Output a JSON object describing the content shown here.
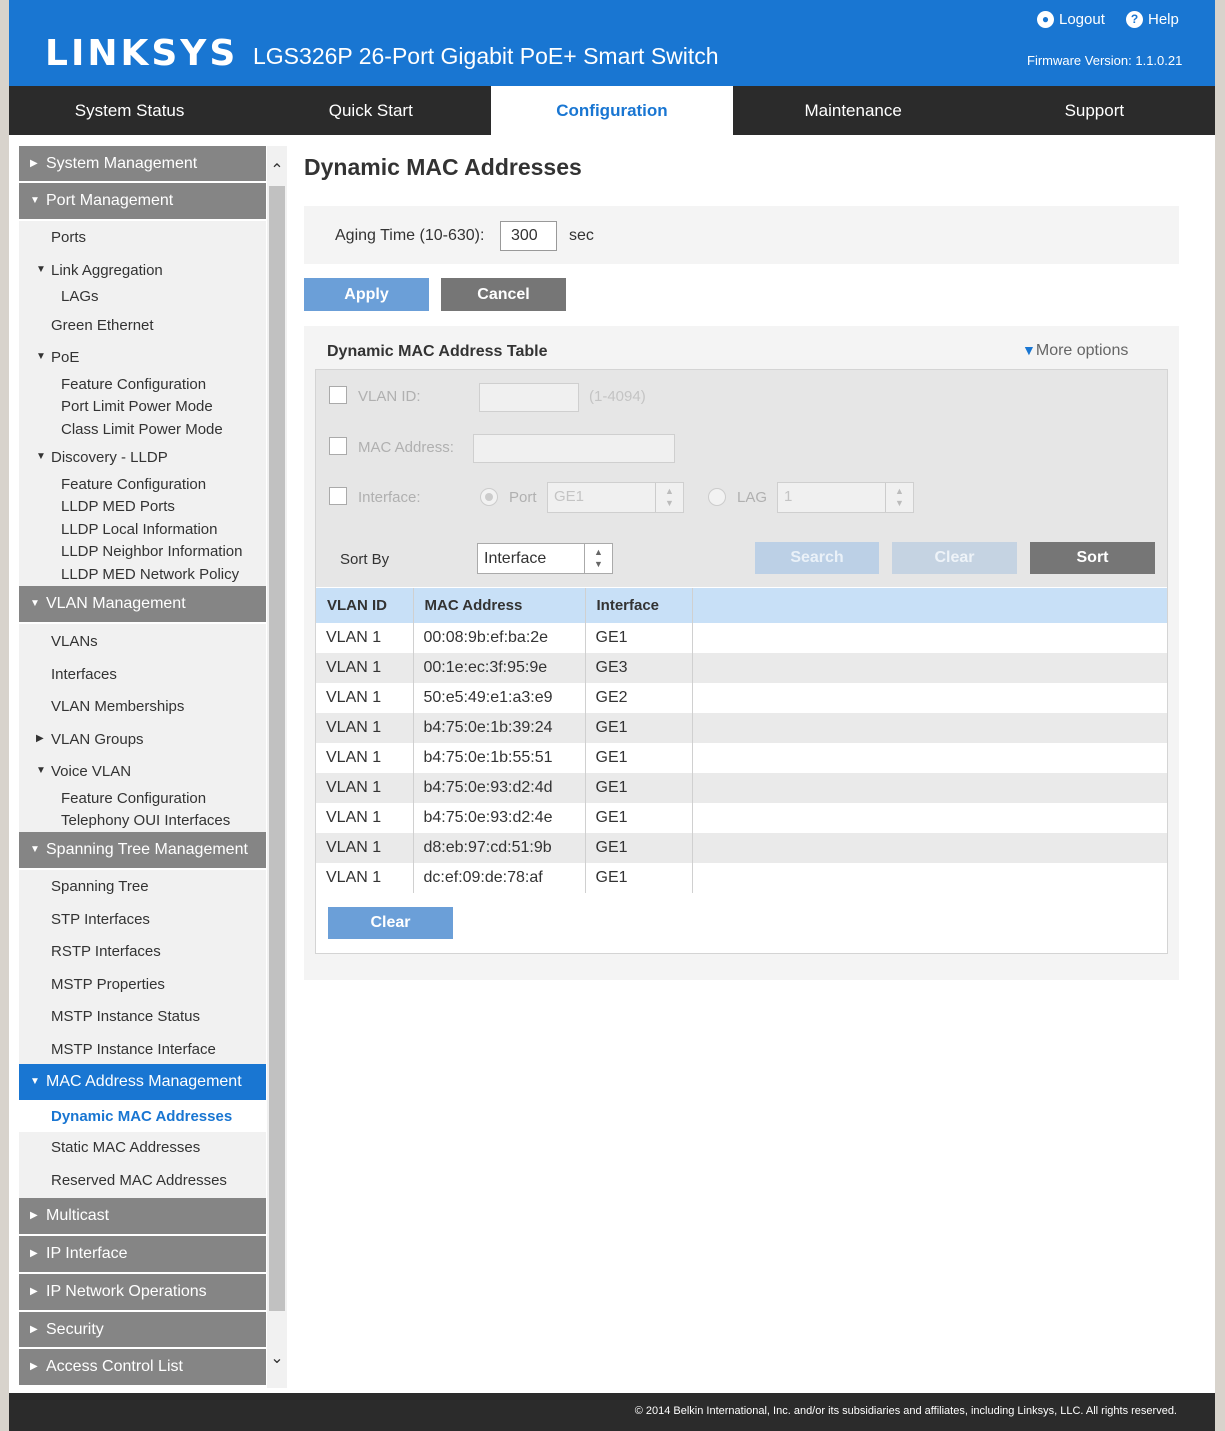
{
  "header": {
    "logo": "LINKSYS",
    "product": "LGS326P 26-Port Gigabit PoE+ Smart Switch",
    "logout": "Logout",
    "help": "Help",
    "firmware": "Firmware Version: 1.1.0.21"
  },
  "nav": {
    "tabs": [
      "System Status",
      "Quick Start",
      "Configuration",
      "Maintenance",
      "Support"
    ],
    "active": "Configuration"
  },
  "sidebar": {
    "system_management": "System Management",
    "port_management": "Port Management",
    "ports": "Ports",
    "link_aggregation": "Link Aggregation",
    "lags": "LAGs",
    "green_ethernet": "Green Ethernet",
    "poe": "PoE",
    "poe_feature_configuration": "Feature Configuration",
    "port_limit_power_mode": "Port Limit Power Mode",
    "class_limit_power_mode": "Class Limit Power Mode",
    "discovery_lldp": "Discovery - LLDP",
    "lldp_feature_configuration": "Feature Configuration",
    "lldp_med_ports": "LLDP MED Ports",
    "lldp_local_information": "LLDP Local Information",
    "lldp_neighbor_information": "LLDP Neighbor Information",
    "lldp_med_network_policy": "LLDP MED Network Policy",
    "vlan_management": "VLAN Management",
    "vlans": "VLANs",
    "interfaces": "Interfaces",
    "vlan_memberships": "VLAN Memberships",
    "vlan_groups": "VLAN Groups",
    "voice_vlan": "Voice VLAN",
    "voice_feature_configuration": "Feature Configuration",
    "telephony_oui_interfaces": "Telephony OUI Interfaces",
    "spanning_tree_management": "Spanning Tree Management",
    "spanning_tree": "Spanning Tree",
    "stp_interfaces": "STP Interfaces",
    "rstp_interfaces": "RSTP Interfaces",
    "mstp_properties": "MSTP Properties",
    "mstp_instance_status": "MSTP Instance Status",
    "mstp_instance_interface": "MSTP Instance Interface",
    "mac_address_management": "MAC Address Management",
    "dynamic_mac_addresses": "Dynamic MAC Addresses",
    "static_mac_addresses": "Static MAC Addresses",
    "reserved_mac_addresses": "Reserved MAC Addresses",
    "multicast": "Multicast",
    "ip_interface": "IP Interface",
    "ip_network_operations": "IP Network Operations",
    "security": "Security",
    "access_control_list": "Access Control List"
  },
  "main": {
    "title": "Dynamic MAC Addresses",
    "aging_label": "Aging Time (10-630):",
    "aging_value": "300",
    "aging_unit": "sec",
    "apply": "Apply",
    "cancel": "Cancel",
    "table_title": "Dynamic MAC Address Table",
    "more_options": "More options",
    "filter": {
      "vlan_id_label": "VLAN ID:",
      "vlan_id_range": "(1-4094)",
      "mac_label": "MAC Address:",
      "interface_label": "Interface:",
      "port_label": "Port",
      "port_value": "GE1",
      "lag_label": "LAG",
      "lag_value": "1",
      "sort_by_label": "Sort By",
      "sort_by_value": "Interface",
      "search": "Search",
      "clear": "Clear",
      "sort": "Sort"
    },
    "columns": [
      "VLAN ID",
      "MAC Address",
      "Interface"
    ],
    "rows": [
      [
        "VLAN 1",
        "00:08:9b:ef:ba:2e",
        "GE1"
      ],
      [
        "VLAN 1",
        "00:1e:ec:3f:95:9e",
        "GE3"
      ],
      [
        "VLAN 1",
        "50:e5:49:e1:a3:e9",
        "GE2"
      ],
      [
        "VLAN 1",
        "b4:75:0e:1b:39:24",
        "GE1"
      ],
      [
        "VLAN 1",
        "b4:75:0e:1b:55:51",
        "GE1"
      ],
      [
        "VLAN 1",
        "b4:75:0e:93:d2:4d",
        "GE1"
      ],
      [
        "VLAN 1",
        "b4:75:0e:93:d2:4e",
        "GE1"
      ],
      [
        "VLAN 1",
        "d8:eb:97:cd:51:9b",
        "GE1"
      ],
      [
        "VLAN 1",
        "dc:ef:09:de:78:af",
        "GE1"
      ]
    ],
    "clear_table": "Clear"
  },
  "footer": {
    "copyright": "© 2014 Belkin International, Inc. and/or its subsidiaries and affiliates, including Linksys, LLC. All rights reserved."
  },
  "colors": {
    "brand_blue": "#1976d2",
    "nav_dark": "#2b2b2b",
    "sidebar_section": "#858585",
    "button_blue": "#6b9fd8",
    "button_gray": "#767676"
  }
}
